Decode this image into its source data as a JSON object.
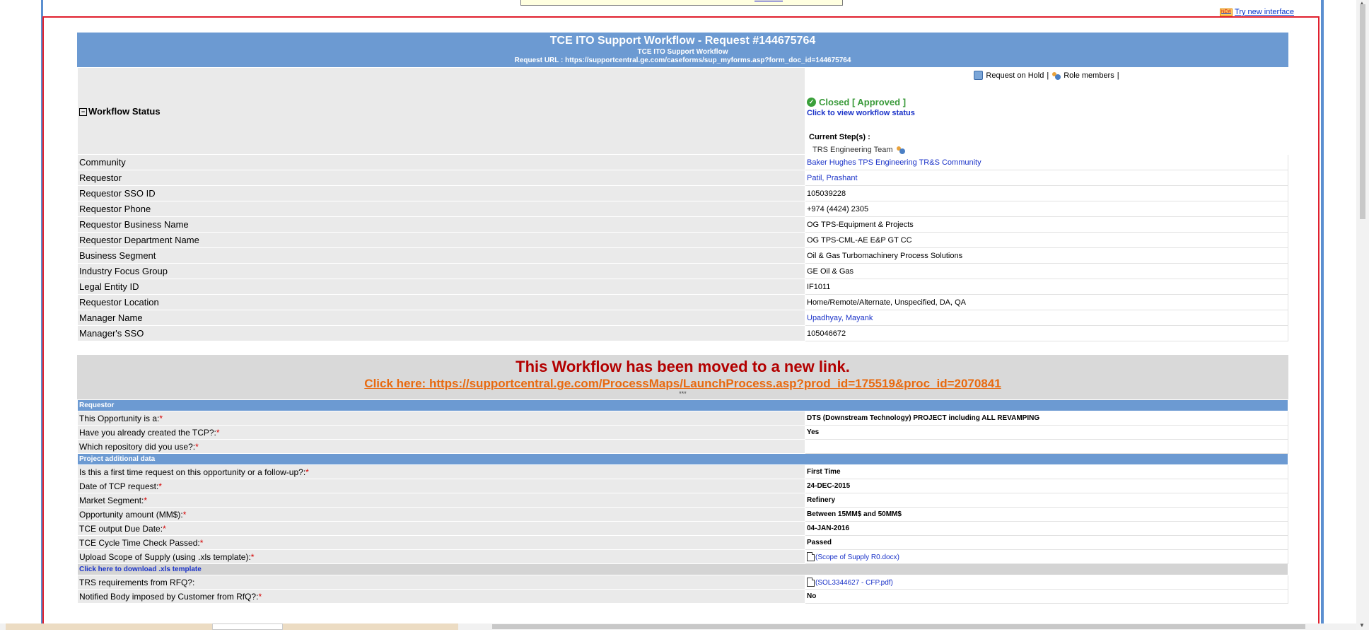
{
  "top": {
    "try_new_interface": "Try new interface"
  },
  "header": {
    "title": "TCE ITO Support Workflow - Request #144675764",
    "subtitle": "TCE ITO Support Workflow",
    "request_url": "Request URL : https://supportcentral.ge.com/caseforms/sup_myforms.asp?form_doc_id=144675764"
  },
  "workflow": {
    "label": "Workflow Status",
    "toggle": "−",
    "action_hold": "Request on Hold",
    "sep": "|",
    "action_roles": "Role members",
    "status": "Closed [ Approved ]",
    "view_status": "Click to view workflow status",
    "current_steps_label": "Current Step(s) :",
    "current_step": "TRS Engineering Team"
  },
  "info_rows": [
    {
      "label": "Community",
      "value": "Baker Hughes TPS Engineering TR&S Community",
      "link": true
    },
    {
      "label": "Requestor",
      "value": "Patil, Prashant",
      "link": true
    },
    {
      "label": "Requestor SSO ID",
      "value": "105039228",
      "link": false
    },
    {
      "label": "Requestor Phone",
      "value": "+974 (4424) 2305",
      "link": false
    },
    {
      "label": "Requestor Business Name",
      "value": "OG TPS-Equipment & Projects",
      "link": false
    },
    {
      "label": "Requestor Department Name",
      "value": "OG TPS-CML-AE E&P GT CC",
      "link": false
    },
    {
      "label": "Business Segment",
      "value": "Oil & Gas Turbomachinery Process Solutions",
      "link": false
    },
    {
      "label": "Industry Focus Group",
      "value": "GE Oil & Gas",
      "link": false
    },
    {
      "label": "Legal Entity ID",
      "value": "IF1011",
      "link": false
    },
    {
      "label": "Requestor Location",
      "value": "Home/Remote/Alternate, Unspecified, DA, QA",
      "link": false
    },
    {
      "label": "Manager Name",
      "value": "Upadhyay, Mayank",
      "link": true
    },
    {
      "label": "Manager's SSO",
      "value": "105046672",
      "link": false
    }
  ],
  "notice": {
    "title": "This Workflow has been moved to a new link.",
    "link": "Click here: https://supportcentral.ge.com/ProcessMaps/LaunchProcess.asp?prod_id=175519&proc_id=2070841",
    "marker": "***"
  },
  "form": {
    "required_mark": "*",
    "section_requestor": "Requestor",
    "section_project": "Project additional data",
    "download_template": "Click here to download .xls template",
    "q1": {
      "label": "This Opportunity is a:",
      "value": "DTS (Downstream Technology) PROJECT including ALL REVAMPING"
    },
    "q2": {
      "label": "Have you already created the TCP?:",
      "value": "Yes"
    },
    "q3": {
      "label": "Which repository did you use?:",
      "value": ""
    },
    "q4": {
      "label": "Is this a first time request on this opportunity or a follow-up?:",
      "value": "First Time"
    },
    "q5": {
      "label": "Date of TCP request:",
      "value": "24-DEC-2015"
    },
    "q6": {
      "label": "Market Segment:",
      "value": "Refinery"
    },
    "q7": {
      "label": "Opportunity amount (MM$):",
      "value": "Between 15MM$ and 50MM$"
    },
    "q8": {
      "label": "TCE output Due Date:",
      "value": "04-JAN-2016"
    },
    "q9": {
      "label": "TCE Cycle Time Check Passed:",
      "value": "Passed"
    },
    "q10": {
      "label": "Upload Scope of Supply (using .xls template):",
      "value": "(Scope of Supply R0.docx)"
    },
    "q11": {
      "label": "TRS requirements from RFQ?:",
      "value": "(SOL3344627 - CFP.pdf)"
    },
    "q12": {
      "label": "Notified Body imposed by Customer from RfQ?:",
      "value": "No"
    }
  },
  "icons": {
    "hold": "hold-icon",
    "roles": "people-icon",
    "status": "check-circle-icon",
    "team": "people-icon",
    "file": "file-icon",
    "new_badge": "new-badge-icon"
  },
  "colors": {
    "header_blue": "#6c9ad2",
    "frame_red": "#e0202e",
    "status_green": "#3a9a3a",
    "notice_red": "#b30000",
    "notice_orange": "#e86a10",
    "link_blue": "#1a32c8"
  }
}
